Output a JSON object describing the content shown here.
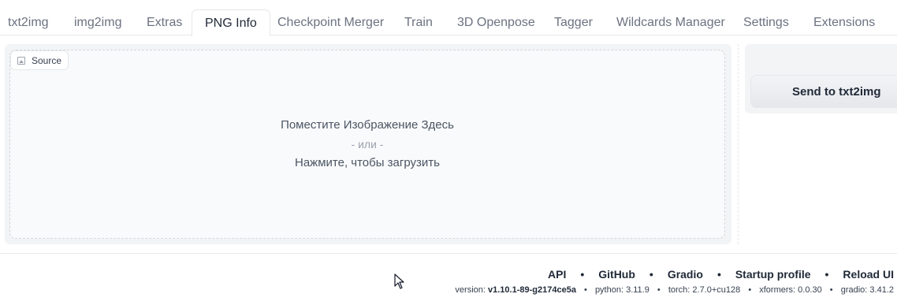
{
  "tabs": [
    {
      "label": "txt2img",
      "active": false
    },
    {
      "label": "img2img",
      "active": false
    },
    {
      "label": "Extras",
      "active": false
    },
    {
      "label": "PNG Info",
      "active": true
    },
    {
      "label": "Checkpoint Merger",
      "active": false
    },
    {
      "label": "Train",
      "active": false
    },
    {
      "label": "3D Openpose",
      "active": false
    },
    {
      "label": "Tagger",
      "active": false
    },
    {
      "label": "Wildcards Manager",
      "active": false
    },
    {
      "label": "Settings",
      "active": false
    },
    {
      "label": "Extensions",
      "active": false
    }
  ],
  "upload": {
    "source_label": "Source",
    "drop_here": "Поместите Изображение Здесь",
    "or": "- или -",
    "click_to_upload": "Нажмите, чтобы загрузить"
  },
  "actions": {
    "send_to_txt2img": "Send to txt2img"
  },
  "footer": {
    "links": [
      "API",
      "GitHub",
      "Gradio",
      "Startup profile",
      "Reload UI"
    ],
    "separator": "•",
    "version_label": "version:",
    "version_value": "v1.10.1-89-g2174ce5a",
    "python": "python: 3.11.9",
    "torch": "torch: 2.7.0+cu128",
    "xformers": "xformers: 0.0.30",
    "gradio": "gradio: 3.41.2"
  },
  "colors": {
    "panel_bg": "#f3f4f6",
    "border": "#e5e7eb",
    "text": "#374151"
  }
}
